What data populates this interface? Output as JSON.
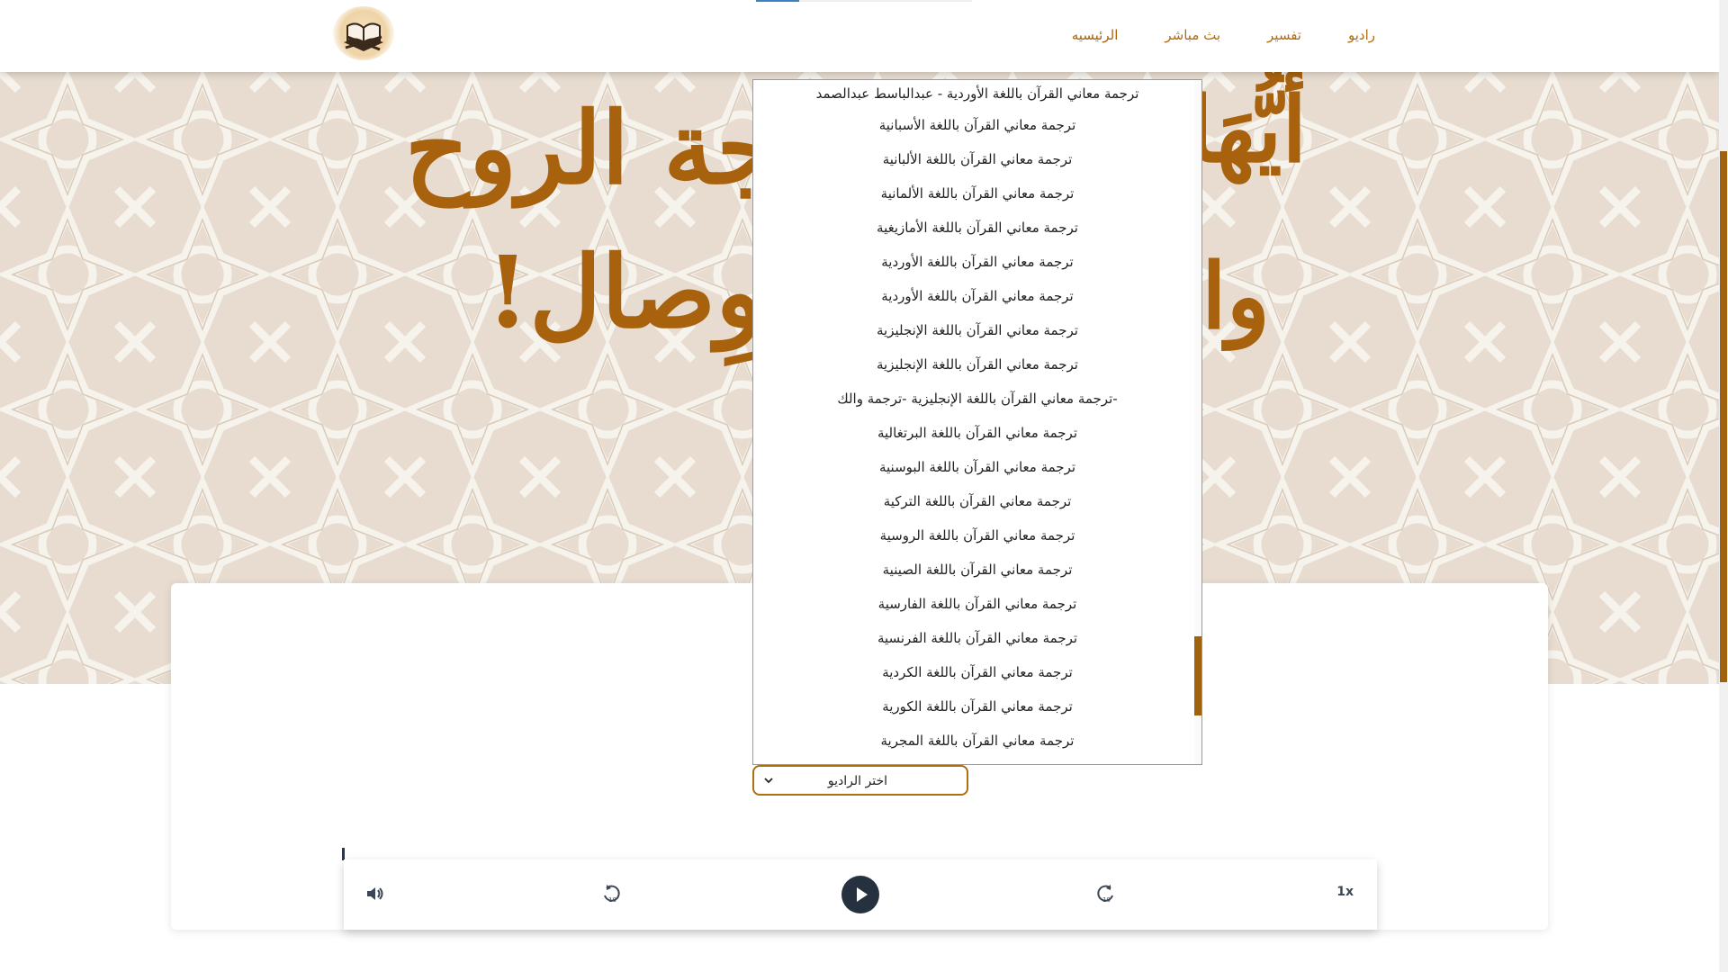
{
  "nav": {
    "links": [
      {
        "label": "راديو"
      },
      {
        "label": "تفسير"
      },
      {
        "label": "بث مباشر"
      },
      {
        "label": "الرئيسيه"
      }
    ],
    "logo": "quran-book-icon"
  },
  "hero": {
    "title_line1": "أَيُّهَا",
    "title_line1_left": "بَهجة الروح",
    "title_line2_right": "وا",
    "title_line2_left": "للوِصال!"
  },
  "radio_select": {
    "selected": "اختر الراديو"
  },
  "dropdown_options": [
    "ترجمة معاني القرآن باللغة الأوردية - عبدالباسط عبدالصمد",
    "ترجمة معاني القرآن باللغة الأسبانية",
    "ترجمة معاني القرآن باللغة الألبانية",
    "ترجمة معاني القرآن باللغة الألمانية",
    "ترجمة معاني القرآن باللغة الأمازيغية",
    "ترجمة معاني القرآن باللغة الأوردية",
    "ترجمة معاني القرآن باللغة الأوردية",
    "ترجمة معاني القرآن باللغة الإنجليزية",
    "ترجمة معاني القرآن باللغة الإنجليزية",
    "-ترجمة معاني القرآن باللغة الإنجليزية -ترجمة والك",
    "ترجمة معاني القرآن باللغة البرتغالية",
    "ترجمة معاني القرآن باللغة البوسنية",
    "ترجمة معاني القرآن باللغة التركية",
    "ترجمة معاني القرآن باللغة الروسية",
    "ترجمة معاني القرآن باللغة الصينية",
    "ترجمة معاني القرآن باللغة الفارسية",
    "ترجمة معاني القرآن باللغة الفرنسية",
    "ترجمة معاني القرآن باللغة الكردية",
    "ترجمة معاني القرآن باللغة الكورية",
    "ترجمة معاني القرآن باللغة المجرية"
  ],
  "player": {
    "speed": "1x",
    "icons": [
      "volume-icon",
      "rewind-10-icon",
      "play-icon",
      "forward-10-icon"
    ]
  },
  "colors": {
    "accent": "#b06d12",
    "hero_text": "#a8620e",
    "player_dark": "#26313f"
  }
}
